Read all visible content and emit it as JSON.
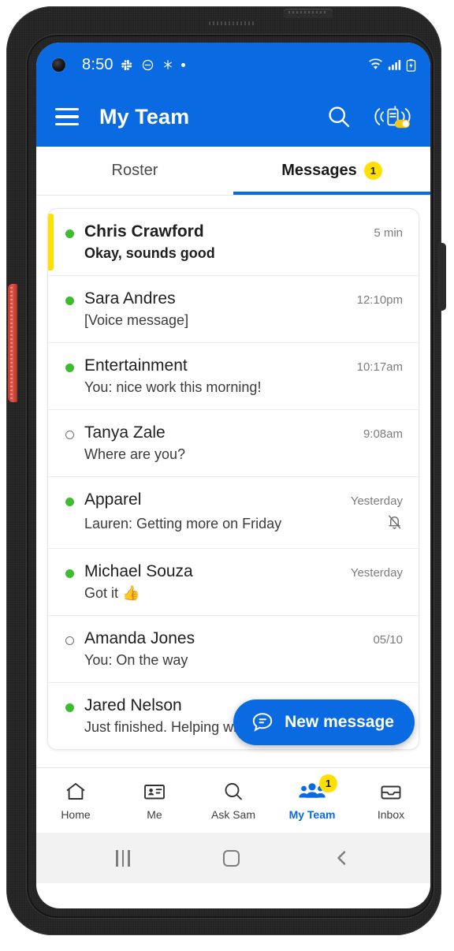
{
  "status_bar": {
    "time": "8:50",
    "left_icons": [
      "slack-icon",
      "do-not-disturb-icon",
      "bluetooth-icon",
      "dot-icon"
    ],
    "right_icons": [
      "wifi-icon",
      "cellular-signal-icon",
      "battery-charging-icon"
    ]
  },
  "app_bar": {
    "title": "My Team",
    "menu_icon": "hamburger-menu-icon",
    "search_icon": "search-icon",
    "walkie_talkie_icon": "walkie-talkie-toggle-icon",
    "background_color": "#0a6ae1"
  },
  "tabs": [
    {
      "label": "Roster",
      "active": false,
      "badge": null
    },
    {
      "label": "Messages",
      "active": true,
      "badge": "1"
    }
  ],
  "messages": [
    {
      "name": "Chris Crawford",
      "preview": "Okay, sounds good",
      "time": "5 min",
      "presence": "online",
      "unread": true,
      "muted": false
    },
    {
      "name": "Sara Andres",
      "preview": "[Voice message]",
      "time": "12:10pm",
      "presence": "online",
      "unread": false,
      "muted": false
    },
    {
      "name": "Entertainment",
      "preview": "You: nice work this morning!",
      "time": "10:17am",
      "presence": "online",
      "unread": false,
      "muted": false
    },
    {
      "name": "Tanya Zale",
      "preview": "Where are you?",
      "time": "9:08am",
      "presence": "offline",
      "unread": false,
      "muted": false
    },
    {
      "name": "Apparel",
      "preview": "Lauren: Getting more on Friday",
      "time": "Yesterday",
      "presence": "online",
      "unread": false,
      "muted": true
    },
    {
      "name": "Michael Souza",
      "preview": "Got it 👍",
      "time": "Yesterday",
      "presence": "online",
      "unread": false,
      "muted": false
    },
    {
      "name": "Amanda Jones",
      "preview": "You: On the way",
      "time": "05/10",
      "presence": "offline",
      "unread": false,
      "muted": false
    },
    {
      "name": "Jared Nelson",
      "preview": "Just finished. Helping with a carry out now",
      "time": "",
      "presence": "online",
      "unread": false,
      "muted": false
    }
  ],
  "fab": {
    "label": "New message",
    "icon": "chat-bubble-icon",
    "color": "#0a6ae1"
  },
  "bottom_nav": [
    {
      "label": "Home",
      "icon": "home-icon",
      "active": false,
      "badge": null
    },
    {
      "label": "Me",
      "icon": "id-card-icon",
      "active": false,
      "badge": null
    },
    {
      "label": "Ask Sam",
      "icon": "search-icon",
      "active": false,
      "badge": null
    },
    {
      "label": "My Team",
      "icon": "people-group-icon",
      "active": true,
      "badge": "1"
    },
    {
      "label": "Inbox",
      "icon": "inbox-tray-icon",
      "active": false,
      "badge": null
    }
  ],
  "system_nav": {
    "recents": "recents-icon",
    "home": "home-square-icon",
    "back": "back-chevron-icon"
  },
  "colors": {
    "brand_blue": "#0a6ae1",
    "badge_yellow": "#ffe000",
    "presence_green": "#3dbd2e"
  }
}
